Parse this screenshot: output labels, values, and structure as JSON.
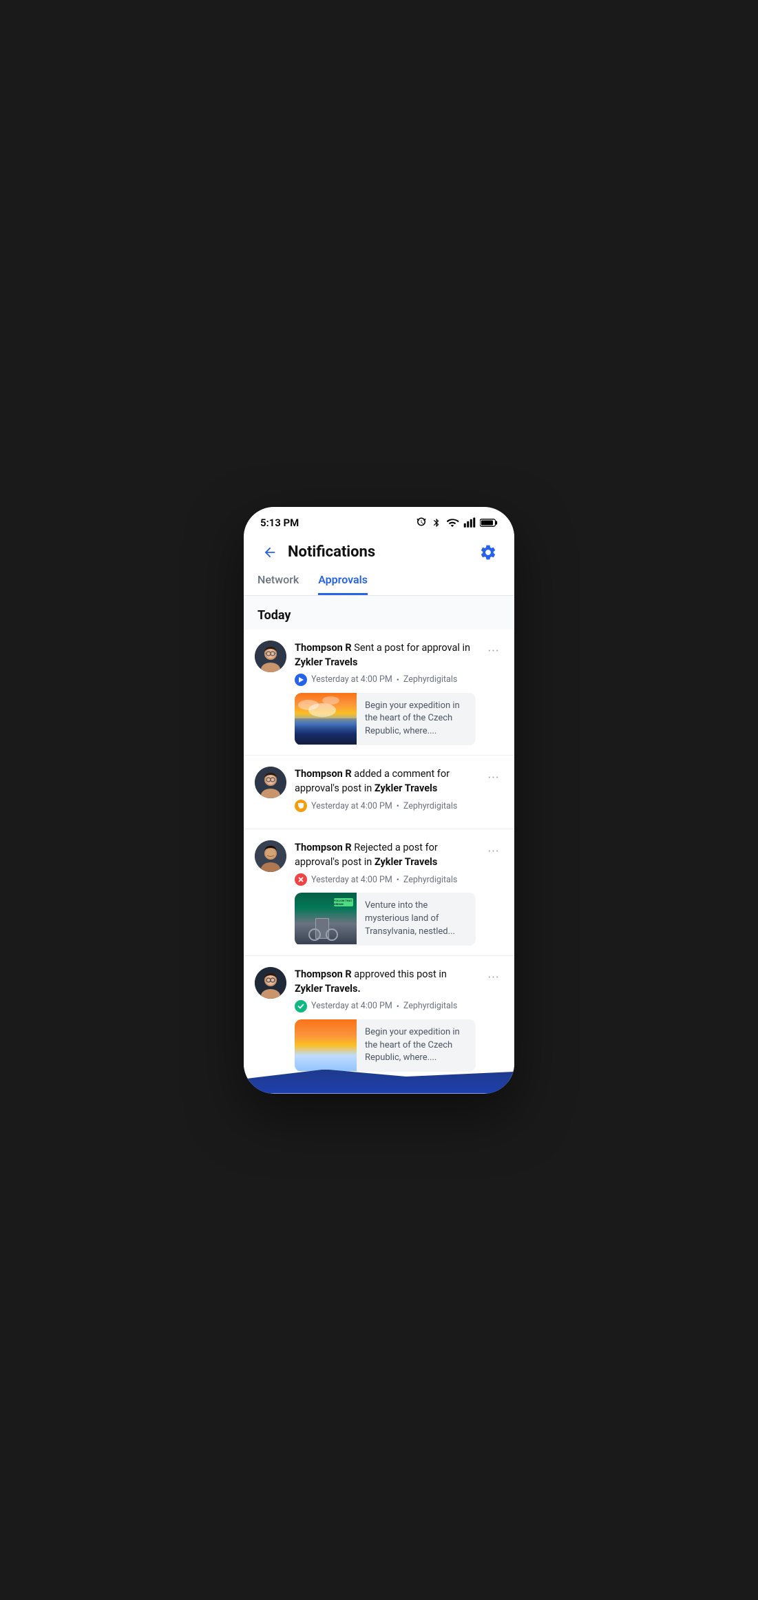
{
  "statusBar": {
    "time": "5:13 PM"
  },
  "header": {
    "title": "Notifications",
    "backLabel": "←",
    "settingsLabel": "⚙"
  },
  "tabs": [
    {
      "id": "network",
      "label": "Network",
      "active": false
    },
    {
      "id": "approvals",
      "label": "Approvals",
      "active": true
    }
  ],
  "sections": [
    {
      "title": "Today",
      "notifications": [
        {
          "id": 1,
          "user": "Thompson R",
          "action": " Sent a post for approval in ",
          "target": "Zykler Travels",
          "time": "Yesterday at 4:00 PM",
          "dot": "•",
          "source": "Zephyrdigitals",
          "statusType": "blue",
          "statusIcon": "▶",
          "hasPreview": true,
          "previewText": "Begin your expedition in the heart of the Czech Republic, where...."
        },
        {
          "id": 2,
          "user": "Thompson R",
          "action": " added a comment for approval's post in ",
          "target": "Zykler Travels",
          "time": "Yesterday at 4:00 PM",
          "dot": "•",
          "source": "Zephyrdigitals",
          "statusType": "yellow",
          "statusIcon": "💬",
          "hasPreview": false,
          "previewText": ""
        },
        {
          "id": 3,
          "user": "Thompson R",
          "action": " Rejected a post for approval's post in ",
          "target": "Zykler Travels",
          "time": "Yesterday at 4:00 PM",
          "dot": "•",
          "source": "Zephyrdigitals",
          "statusType": "red",
          "statusIcon": "✕",
          "hasPreview": true,
          "previewText": "Venture into the mysterious land of Transylvania, nestled..."
        },
        {
          "id": 4,
          "user": "Thompson R",
          "action": " approved this post in ",
          "target": "Zykler Travels.",
          "time": "Yesterday at 4:00 PM",
          "dot": "•",
          "source": "Zephyrdigitals",
          "statusType": "green",
          "statusIcon": "✓",
          "hasPreview": true,
          "previewText": "Begin your expedition in the heart of the Czech Republic, where...."
        }
      ]
    }
  ],
  "moreLabel": "•••"
}
